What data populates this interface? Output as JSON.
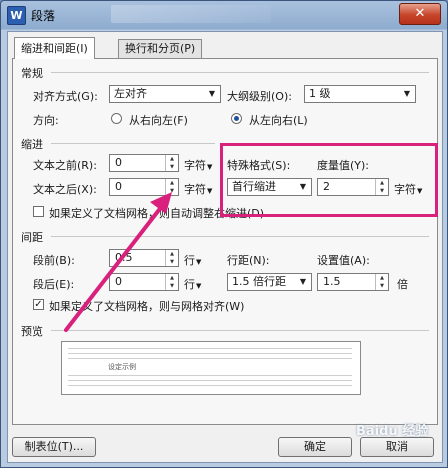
{
  "window": {
    "title": "段落",
    "app_icon_letter": "W",
    "close_symbol": "✕"
  },
  "tabs": [
    {
      "label": "缩进和间距(I)",
      "active": true
    },
    {
      "label": "换行和分页(P)",
      "active": false
    }
  ],
  "general": {
    "section_title": "常规",
    "alignment_label": "对齐方式(G):",
    "alignment_value": "左对齐",
    "outline_label": "大纲级别(O):",
    "outline_value": "1 级",
    "direction_label": "方向:",
    "rtl_label": "从右向左(F)",
    "ltr_label": "从左向右(L)",
    "direction_selected": "ltr"
  },
  "indent": {
    "section_title": "缩进",
    "before_label": "文本之前(R):",
    "before_value": "0",
    "before_unit": "字符",
    "after_label": "文本之后(X):",
    "after_value": "0",
    "after_unit": "字符",
    "special_label": "特殊格式(S):",
    "special_value": "首行缩进",
    "measure_label": "度量值(Y):",
    "measure_value": "2",
    "measure_unit": "字符",
    "grid_check_label": "如果定义了文档网格，则自动调整右缩进(D)",
    "grid_checked": false
  },
  "spacing": {
    "section_title": "间距",
    "before_label": "段前(B):",
    "before_value": "0.5",
    "before_unit": "行",
    "after_label": "段后(E):",
    "after_value": "0",
    "after_unit": "行",
    "line_label": "行距(N):",
    "line_value": "1.5 倍行距",
    "setting_label": "设置值(A):",
    "setting_value": "1.5",
    "setting_unit": "倍",
    "grid_check_label": "如果定义了文档网格，则与网格对齐(W)",
    "grid_checked": true
  },
  "preview": {
    "section_title": "预览",
    "sample_text": "设定示例"
  },
  "buttons": {
    "tabs_label": "制表位(T)...",
    "ok_label": "确定",
    "cancel_label": "取消"
  },
  "annotation": {
    "highlight_color": "#d8207c"
  },
  "watermark": "Baidu 经验",
  "symbols": {
    "check": "✓",
    "caret": "▼",
    "spin_up": "▲",
    "spin_down": "▼"
  }
}
